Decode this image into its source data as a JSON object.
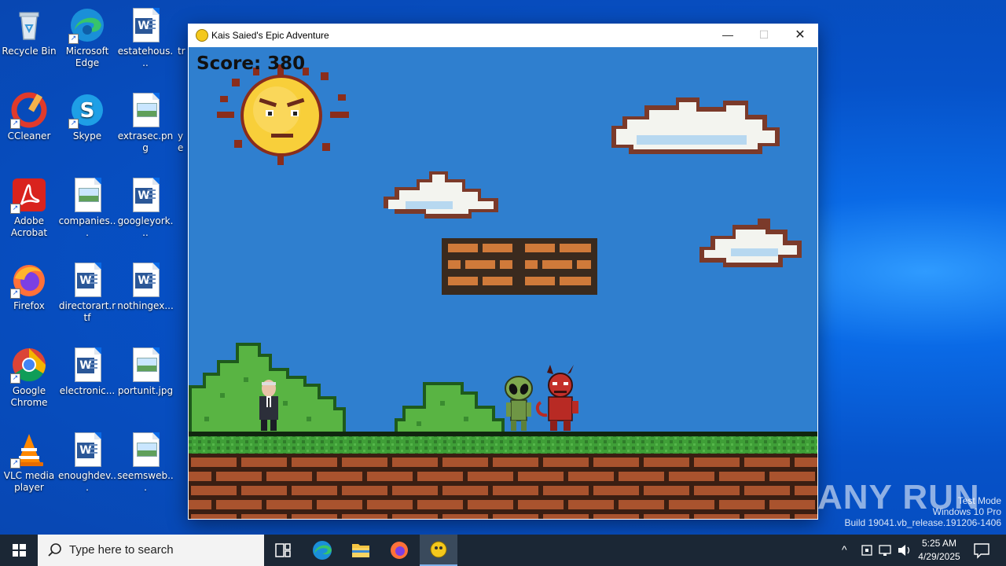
{
  "desktop": {
    "icons": [
      {
        "label": "Recycle Bin",
        "icon": "recycle-bin-icon"
      },
      {
        "label": "Microsoft Edge",
        "icon": "edge-icon"
      },
      {
        "label": "estatehous...",
        "icon": "word-doc-icon"
      },
      {
        "label": "tr",
        "icon": "image-file-icon"
      },
      {
        "label": "CCleaner",
        "icon": "ccleaner-icon"
      },
      {
        "label": "Skype",
        "icon": "skype-icon"
      },
      {
        "label": "extrasec.png",
        "icon": "image-file-icon"
      },
      {
        "label": "ye",
        "icon": "image-file-icon"
      },
      {
        "label": "Adobe Acrobat",
        "icon": "acrobat-icon"
      },
      {
        "label": "companies...",
        "icon": "image-file-icon"
      },
      {
        "label": "googleyork...",
        "icon": "word-doc-icon"
      },
      {
        "label": "Firefox",
        "icon": "firefox-icon"
      },
      {
        "label": "directorart.rtf",
        "icon": "word-doc-icon"
      },
      {
        "label": "nothingex...",
        "icon": "word-doc-icon"
      },
      {
        "label": "Google Chrome",
        "icon": "chrome-icon"
      },
      {
        "label": "electronic...",
        "icon": "word-doc-icon"
      },
      {
        "label": "portunit.jpg",
        "icon": "image-file-icon"
      },
      {
        "label": "VLC media player",
        "icon": "vlc-icon"
      },
      {
        "label": "enoughdev...",
        "icon": "word-doc-icon"
      },
      {
        "label": "seemsweb...",
        "icon": "image-file-icon"
      }
    ]
  },
  "window": {
    "title": "Kais Saied's Epic Adventure",
    "minimize": "—",
    "maximize": "☐",
    "close": "✕"
  },
  "game": {
    "score_label": "Score: 380",
    "sky_color": "#2f7fcf",
    "characters": [
      "player-politician",
      "green-alien",
      "red-devil"
    ]
  },
  "taskbar": {
    "search_placeholder": "Type here to search",
    "time": "5:25 AM",
    "date": "4/29/2025"
  },
  "watermark": {
    "brand": "ANY RUN",
    "line1": "Test Mode",
    "line2": "Windows 10 Pro",
    "line3": "Build 19041.vb_release.191206-1406"
  }
}
